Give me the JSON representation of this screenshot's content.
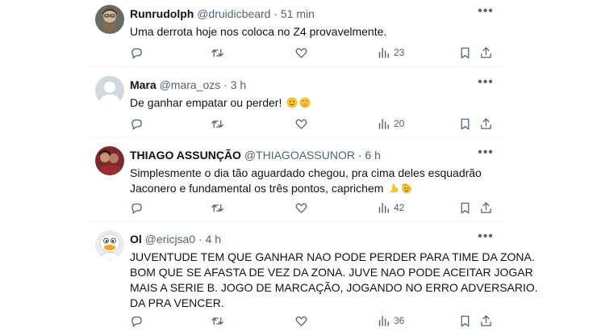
{
  "tweets": [
    {
      "name": "Runrudolph",
      "handle": "@druidicbeard",
      "time": "· 51 min",
      "text": "Uma derrota hoje nos coloca no Z4 provavelmente.",
      "views": "23",
      "avatar": "bearded-man-avatar"
    },
    {
      "name": "Mara",
      "handle": "@mara_ozs",
      "time": "· 3 h",
      "text": "De ganhar empatar ou perder!",
      "emojis": [
        "winking-face-emoji",
        "face-with-hand-over-mouth-emoji"
      ],
      "views": "20",
      "avatar": "default-avatar"
    },
    {
      "name": "THIAGO ASSUNÇÃO",
      "handle": "@THIAGOASSUNOR",
      "time": "· 6 h",
      "text_lines": [
        "Simplesmente o dia tão aguardado chegou, pra cima deles esquadrão",
        "Jaconero e fundamental os três pontos, caprichem"
      ],
      "emojis": [
        "flexed-biceps-emoji",
        "saluting-face-emoji"
      ],
      "views": "42",
      "avatar": "couple-photo-avatar"
    },
    {
      "name": "Ol",
      "handle": "@ericjsa0",
      "time": "· 4 h",
      "text_lines": [
        "JUVENTUDE TEM QUE GANHAR NAO PODE PERDER PARA TIME DA ZONA.",
        "BOM QUE SE AFASTA DE VEZ DA ZONA. JUVE NAO PODE ACEITAR JOGAR",
        "MAIS A SERIE B. JOGO DE MARCAÇÃO, JOGANDO NO ERRO ADVERSARIO.",
        "DA PRA VENCER."
      ],
      "views": "36",
      "avatar": "cartoon-duck-avatar"
    }
  ],
  "colors": {
    "text": "#0f1419",
    "secondary": "#536471",
    "divider": "#eff3f4"
  },
  "icons": [
    "reply-icon",
    "retweet-icon",
    "like-icon",
    "views-icon",
    "bookmark-icon",
    "share-icon",
    "more-icon"
  ]
}
